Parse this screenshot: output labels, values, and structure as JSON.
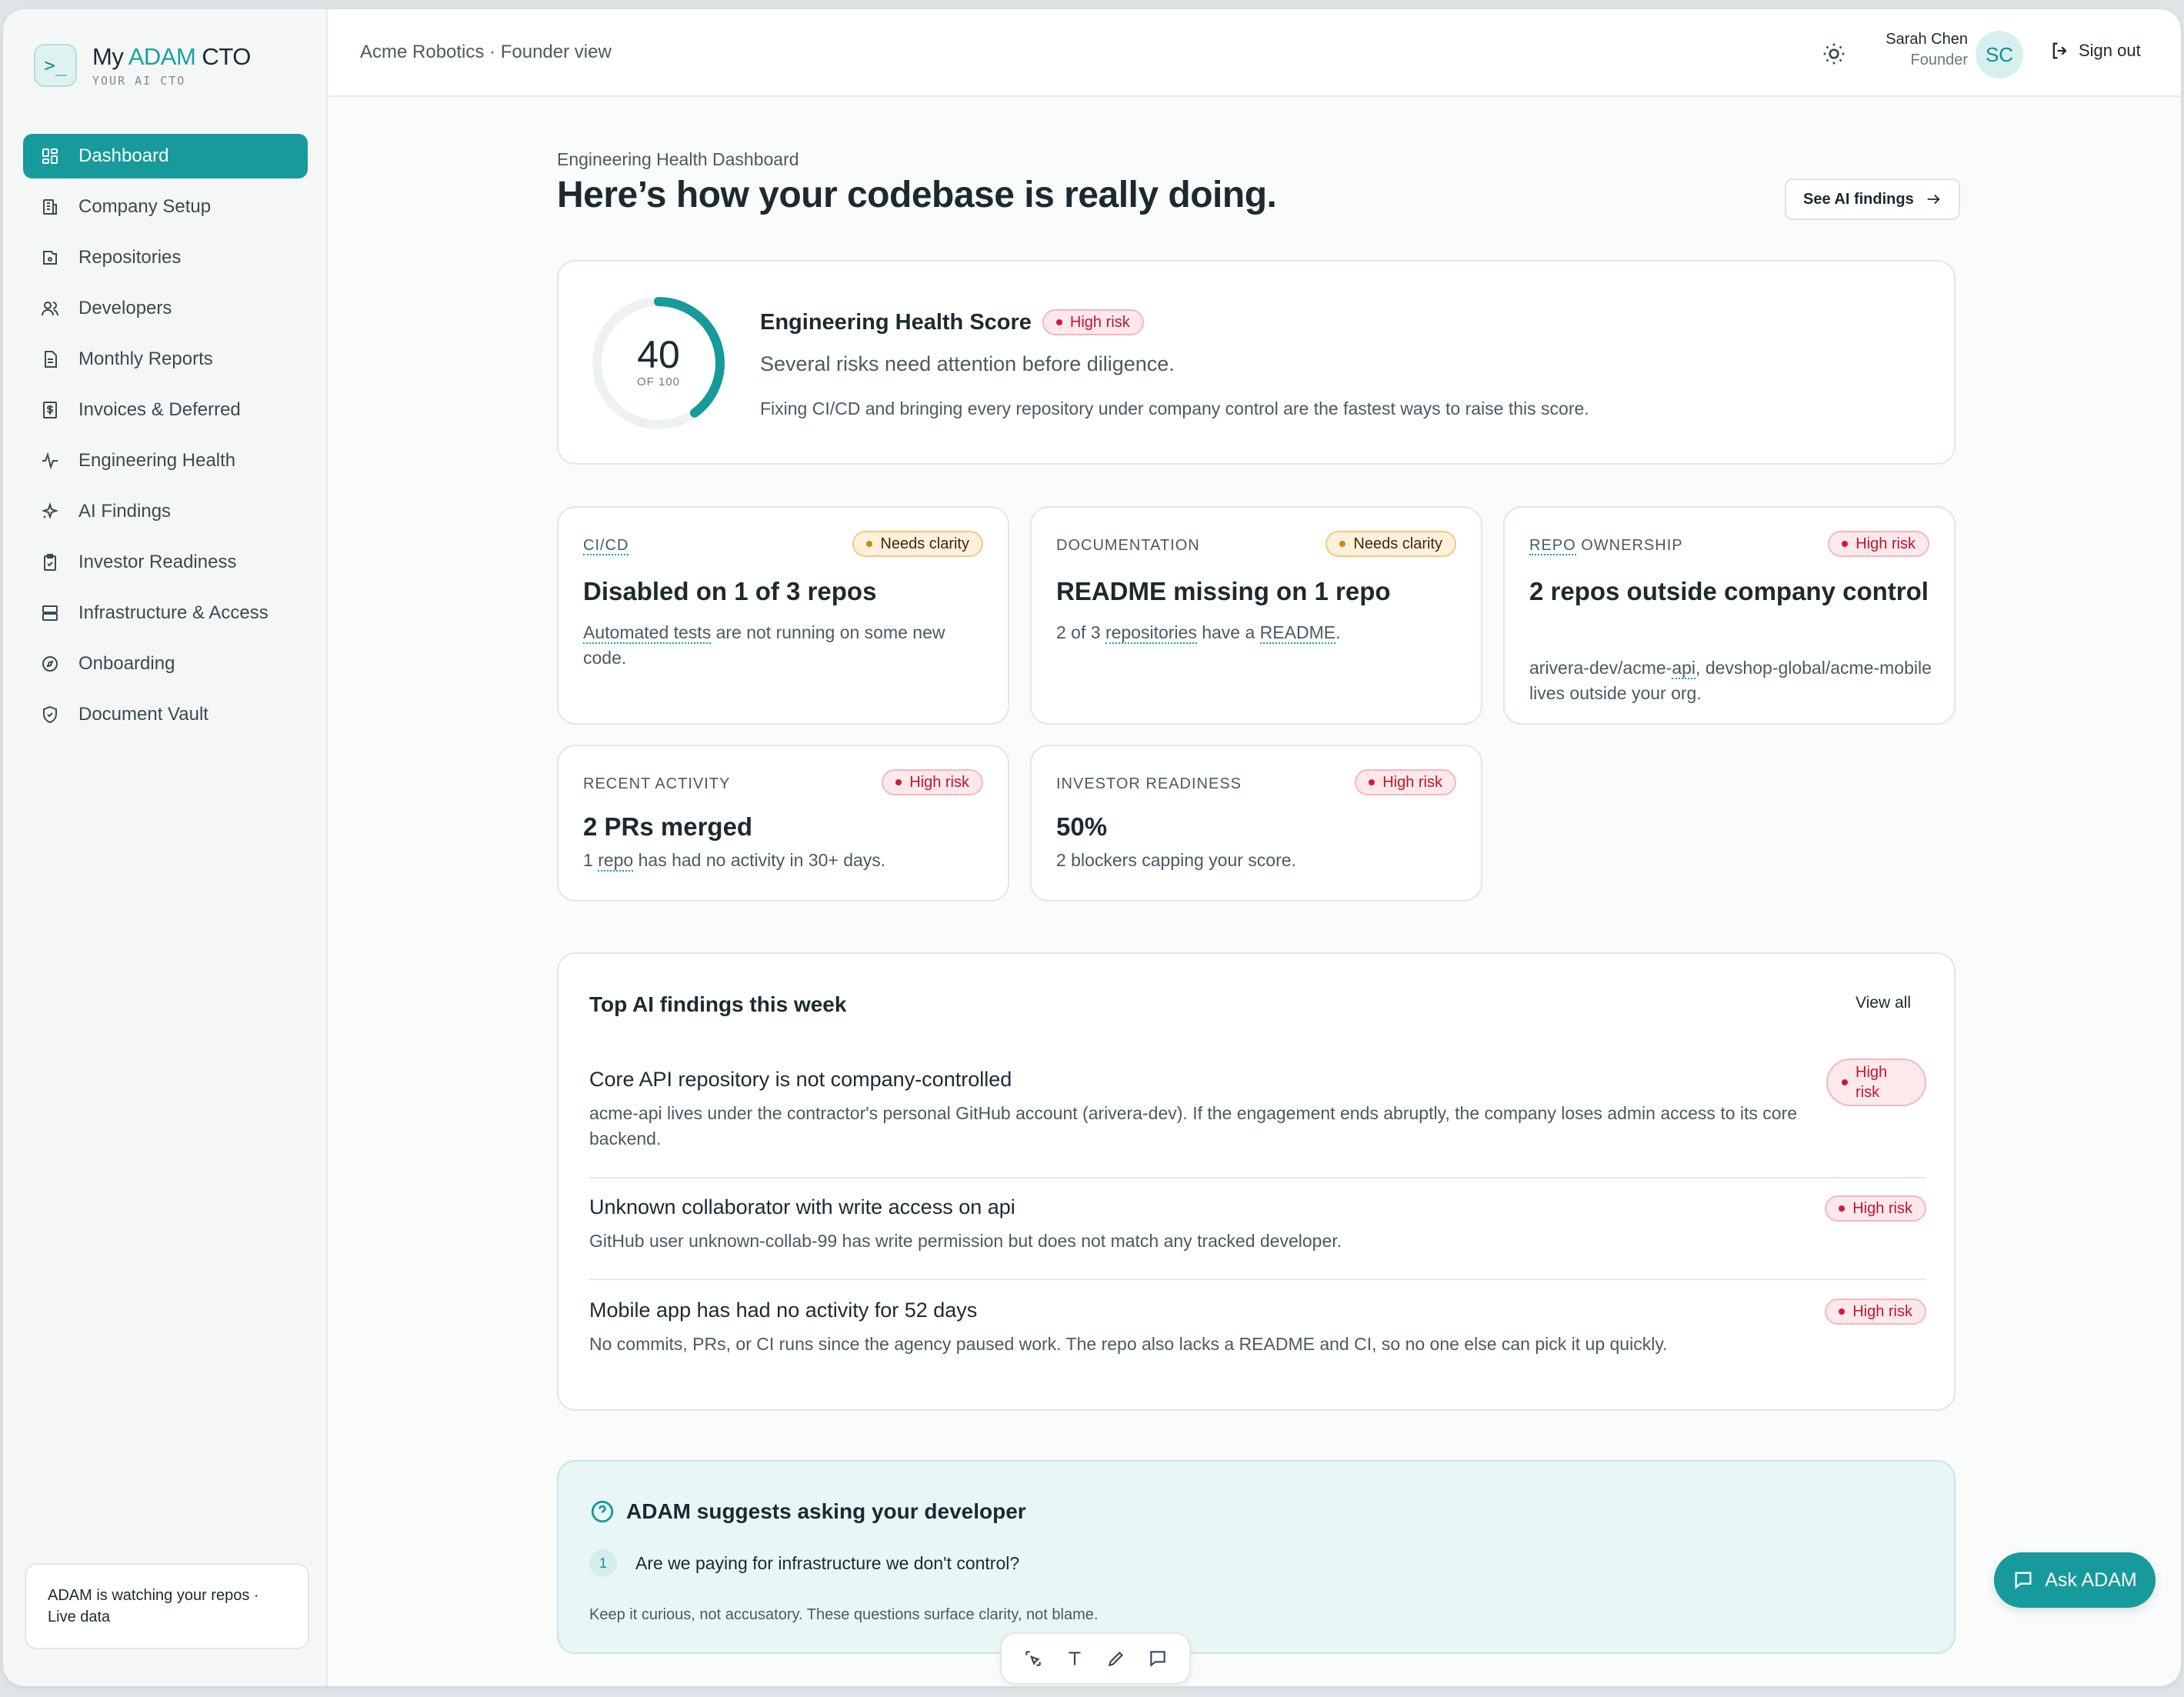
{
  "brand": {
    "name_prefix": "My ",
    "name_accent": "ADAM",
    "name_suffix": " CTO",
    "tagline": "YOUR AI CTO",
    "logo_glyph": ">_"
  },
  "nav": [
    {
      "label": "Dashboard",
      "icon": "dashboard-icon",
      "active": true
    },
    {
      "label": "Company Setup",
      "icon": "building-icon"
    },
    {
      "label": "Repositories",
      "icon": "repo-icon"
    },
    {
      "label": "Developers",
      "icon": "users-icon"
    },
    {
      "label": "Monthly Reports",
      "icon": "report-icon"
    },
    {
      "label": "Invoices & Deferred",
      "icon": "invoice-icon"
    },
    {
      "label": "Engineering Health",
      "icon": "pulse-icon"
    },
    {
      "label": "AI Findings",
      "icon": "sparkle-icon"
    },
    {
      "label": "Investor Readiness",
      "icon": "clipboard-check-icon"
    },
    {
      "label": "Infrastructure & Access",
      "icon": "server-icon"
    },
    {
      "label": "Onboarding",
      "icon": "compass-icon"
    },
    {
      "label": "Document Vault",
      "icon": "shield-check-icon"
    }
  ],
  "watch_card": "ADAM is watching your repos · Live data",
  "header": {
    "context": "Acme Robotics · Founder view",
    "user_name": "Sarah Chen",
    "user_role": "Founder",
    "avatar_initials": "SC",
    "signout": "Sign out"
  },
  "page": {
    "crumb": "Engineering Health Dashboard",
    "title": "Here’s how your codebase is really doing.",
    "see_findings": "See AI findings"
  },
  "score": {
    "value": 40,
    "max": 100,
    "value_text": "40",
    "of_text": "OF 100",
    "title": "Engineering Health Score",
    "badge": "High risk",
    "subtitle": "Several risks need attention before diligence.",
    "note": "Fixing CI/CD and bringing every repository under company control are the fastest ways to raise this score."
  },
  "metrics": {
    "cicd": {
      "label": "CI/CD",
      "badge": "Needs clarity",
      "value": "Disabled on 1 of 3 repos",
      "desc_a": "Automated tests",
      "desc_b": " are not running on some new code."
    },
    "docs": {
      "label": "DOCUMENTATION",
      "badge": "Needs clarity",
      "value": "README missing on 1 repo",
      "desc_a": "2 of 3 ",
      "desc_b": "repositories",
      "desc_c": " have a ",
      "desc_d": "README",
      "desc_e": "."
    },
    "ownership": {
      "label_a": "REPO",
      "label_b": " OWNERSHIP",
      "badge": "High risk",
      "value": "2 repos outside company control",
      "desc_a": "arivera-dev/acme-",
      "desc_b": "api",
      "desc_c": ", devshop-global/acme-mobile lives outside your org."
    },
    "activity": {
      "label": "RECENT ACTIVITY",
      "badge": "High risk",
      "value": "2 PRs merged",
      "desc_a": "1 ",
      "desc_b": "repo",
      "desc_c": " has had no activity in 30+ days."
    },
    "investor": {
      "label": "INVESTOR READINESS",
      "badge": "High risk",
      "value": "50%",
      "desc": "2 blockers capping your score."
    }
  },
  "findings": {
    "title": "Top AI findings this week",
    "view_all": "View all",
    "items": [
      {
        "title": "Core API repository is not company-controlled",
        "desc": "acme-api lives under the contractor's personal GitHub account (arivera-dev). If the engagement ends abruptly, the company loses admin access to its core backend.",
        "badge": "High risk"
      },
      {
        "title": "Unknown collaborator with write access on api",
        "desc": "GitHub user unknown-collab-99 has write permission but does not match any tracked developer.",
        "badge": "High risk"
      },
      {
        "title": "Mobile app has had no activity for 52 days",
        "desc": "No commits, PRs, or CI runs since the agency paused work. The repo also lacks a README and CI, so no one else can pick it up quickly.",
        "badge": "High risk"
      }
    ]
  },
  "suggest": {
    "title": "ADAM suggests asking your developer",
    "q_num": "1",
    "question": "Are we paying for infrastructure we don't control?",
    "note": "Keep it curious, not accusatory. These questions surface clarity, not blame."
  },
  "ask_button": "Ask ADAM",
  "colors": {
    "accent": "#179a9b",
    "high_risk": "#c0142e",
    "needs_clarity": "#d18a0b"
  }
}
